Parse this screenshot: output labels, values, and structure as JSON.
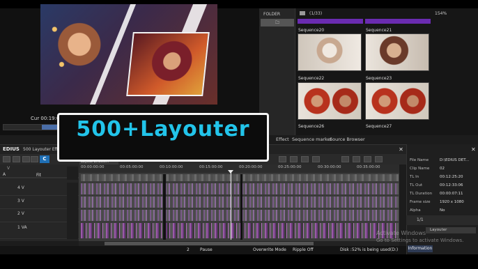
{
  "preview": {
    "timecode": "Cur 00:19:02"
  },
  "banner": {
    "text": "500+Layouter"
  },
  "folder": {
    "label": "FOLDER",
    "button": "🗀"
  },
  "bin": {
    "count": "(1/33)",
    "zoom": "154%",
    "items": [
      {
        "label": "Sequence20"
      },
      {
        "label": "Sequence21"
      },
      {
        "label": "Sequence22"
      },
      {
        "label": "Sequence23"
      },
      {
        "label": "Sequence26"
      },
      {
        "label": "Sequence27"
      }
    ]
  },
  "tabs": [
    "Effect",
    "Sequence marker",
    "Source Browser"
  ],
  "timeline": {
    "app": "EDIUS",
    "project": "500 Layouter Effcts...",
    "tab": "Layout Effects...",
    "fit": "Fit",
    "ruler": [
      "00:00:00:00",
      "00:05:00:00",
      "00:10:00:00",
      "00:15:00:00",
      "00:20:00:00",
      "00:25:00:00",
      "00:30:00:00",
      "00:35:00:00"
    ],
    "tracks": [
      {
        "name": "4 V"
      },
      {
        "name": "3 V"
      },
      {
        "name": "2 V"
      },
      {
        "name": "1 VA"
      }
    ],
    "track_a": "A",
    "v_letter": "V"
  },
  "info": {
    "rows": [
      {
        "key": "File Name",
        "value": "D:\\EDIUS DET..."
      },
      {
        "key": "Clip Name",
        "value": "02"
      },
      {
        "key": "TL In",
        "value": "00:12:25:20"
      },
      {
        "key": "TL Out",
        "value": "00:12:33:06"
      },
      {
        "key": "TL Duration",
        "value": "00:00:07:11"
      },
      {
        "key": "Frame size",
        "value": "1920 x 1080"
      },
      {
        "key": "Alpha",
        "value": "No"
      }
    ],
    "page": "1/1",
    "layer": "Layouter",
    "tab": "Information"
  },
  "status": {
    "page_num": "2",
    "pause": "Pause",
    "overwrite": "Overwrite Mode",
    "ripple": "Ripple Off",
    "disk": "Disk :52% is being used(D:)"
  },
  "watermark": {
    "line1": "Activate Windows",
    "line2": "Go to Settings to activate Windows."
  }
}
